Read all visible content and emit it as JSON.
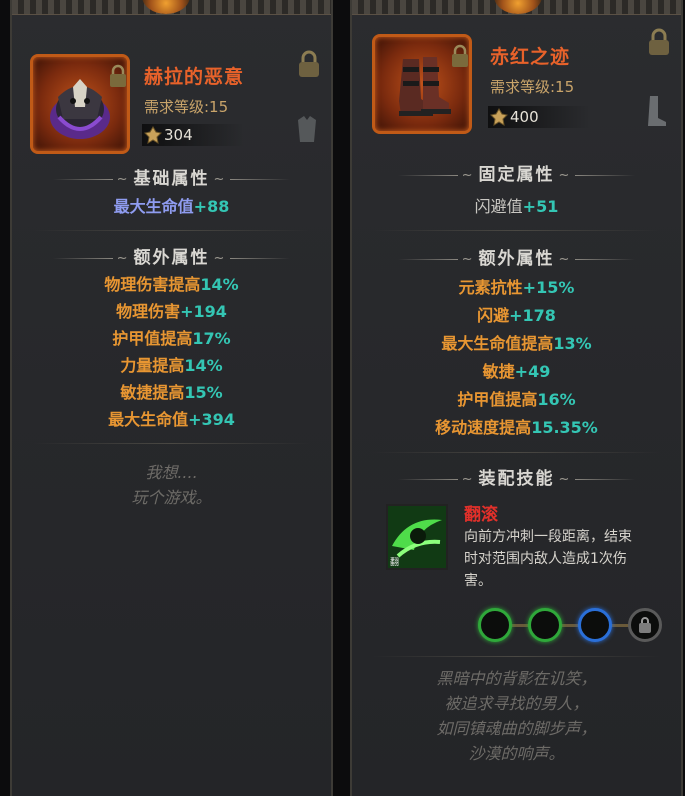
{
  "left": {
    "item_name": "赫拉的恶意",
    "requirement": "需求等级:15",
    "price": "304",
    "sections": {
      "base_title": "基础属性",
      "extra_title": "额外属性"
    },
    "base_stats": [
      {
        "name": "最大生命值",
        "value": "+88"
      }
    ],
    "extra_stats": [
      {
        "name": "物理伤害提高",
        "value": "14%"
      },
      {
        "name": "物理伤害",
        "value": "+194"
      },
      {
        "name": "护甲值提高",
        "value": "17%"
      },
      {
        "name": "力量提高",
        "value": "14%"
      },
      {
        "name": "敏捷提高",
        "value": "15%"
      },
      {
        "name": "最大生命值",
        "value": "+394"
      }
    ],
    "flavor": [
      "我想....",
      "玩个游戏。"
    ]
  },
  "right": {
    "item_name": "赤红之迹",
    "requirement": "需求等级:15",
    "price": "400",
    "sections": {
      "fixed_title": "固定属性",
      "extra_title": "额外属性",
      "skill_title": "装配技能"
    },
    "fixed_stats": [
      {
        "name": "闪避值",
        "value": "+51"
      }
    ],
    "extra_stats": [
      {
        "name": "元素抗性",
        "value": "+15%"
      },
      {
        "name": "闪避",
        "value": "+178"
      },
      {
        "name": "最大生命值提高",
        "value": "13%"
      },
      {
        "name": "敏捷",
        "value": "+49"
      },
      {
        "name": "护甲值提高",
        "value": "16%"
      },
      {
        "name": "移动速度提高",
        "value": "15.35%"
      }
    ],
    "skill": {
      "name": "翻滚",
      "icon_label": "翻",
      "desc_lines": [
        "向前方冲刺一段距离，结束",
        "时对范围内敌人造成1次伤",
        "害。"
      ]
    },
    "sockets": [
      "green",
      "green",
      "blue",
      "locked"
    ],
    "flavor": [
      "黑暗中的背影在讥笑，",
      "被追求寻找的男人，",
      "如同镇魂曲的脚步声，",
      "沙漠的响声。"
    ]
  },
  "colors": {
    "name_orange": "#e8622a",
    "stat_orange": "#e89632",
    "stat_teal": "#34c6b4",
    "base_purple": "#8f9cf0",
    "skill_red": "#e2302a",
    "socket_green": "#2fa83a",
    "socket_blue": "#2a6fd8"
  },
  "icons": [
    "helmet-item-icon",
    "boots-item-icon",
    "padlock-icon",
    "coin-icon",
    "armor-slot-icon",
    "boot-slot-icon",
    "roll-skill-icon"
  ]
}
